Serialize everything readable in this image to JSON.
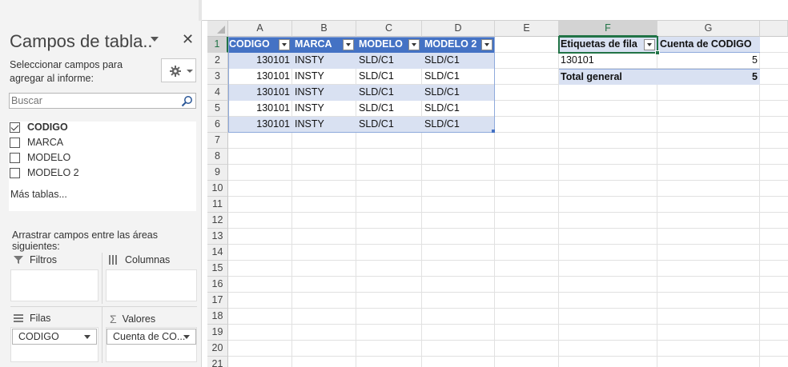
{
  "pane": {
    "title": "Campos de tabla..",
    "close": "✕",
    "hint": "Seleccionar campos para agregar al informe:",
    "search_placeholder": "Buscar",
    "fields": [
      {
        "label": "CODIGO",
        "checked": true
      },
      {
        "label": "MARCA",
        "checked": false
      },
      {
        "label": "MODELO",
        "checked": false
      },
      {
        "label": "MODELO 2",
        "checked": false
      }
    ],
    "more_tables": "Más tablas...",
    "drag_hint": "Arrastrar campos entre las áreas siguientes:",
    "areas": {
      "filters": "Filtros",
      "columns": "Columnas",
      "rows": "Filas",
      "values": "Valores"
    },
    "rows_field": "CODIGO",
    "values_field": "Cuenta de CO..."
  },
  "sheet": {
    "columns": [
      "A",
      "B",
      "C",
      "D",
      "E",
      "F",
      "G"
    ],
    "rows": [
      "1",
      "2",
      "3",
      "4",
      "5",
      "6",
      "7",
      "8",
      "9",
      "10",
      "11",
      "12",
      "13",
      "14",
      "15",
      "16",
      "17",
      "18",
      "19",
      "20",
      "21"
    ],
    "selected_column": "F",
    "selected_row": "1",
    "table": {
      "headers": [
        "CODIGO",
        "MARCA",
        "MODELO",
        "MODELO 2"
      ],
      "data": [
        [
          "130101",
          "INSTY",
          "SLD/C1",
          "SLD/C1"
        ],
        [
          "130101",
          "INSTY",
          "SLD/C1",
          "SLD/C1"
        ],
        [
          "130101",
          "INSTY",
          "SLD/C1",
          "SLD/C1"
        ],
        [
          "130101",
          "INSTY",
          "SLD/C1",
          "SLD/C1"
        ],
        [
          "130101",
          "INSTY",
          "SLD/C1",
          "SLD/C1"
        ]
      ]
    },
    "pivot": {
      "row_label_header": "Etiquetas de fila",
      "value_header": "Cuenta de CODIGO",
      "item_label": "130101",
      "item_value": "5",
      "total_label": "Total general",
      "total_value": "5"
    }
  },
  "colors": {
    "table_header": "#4472c4",
    "band": "#d9e1f2",
    "excel_green": "#217346"
  }
}
